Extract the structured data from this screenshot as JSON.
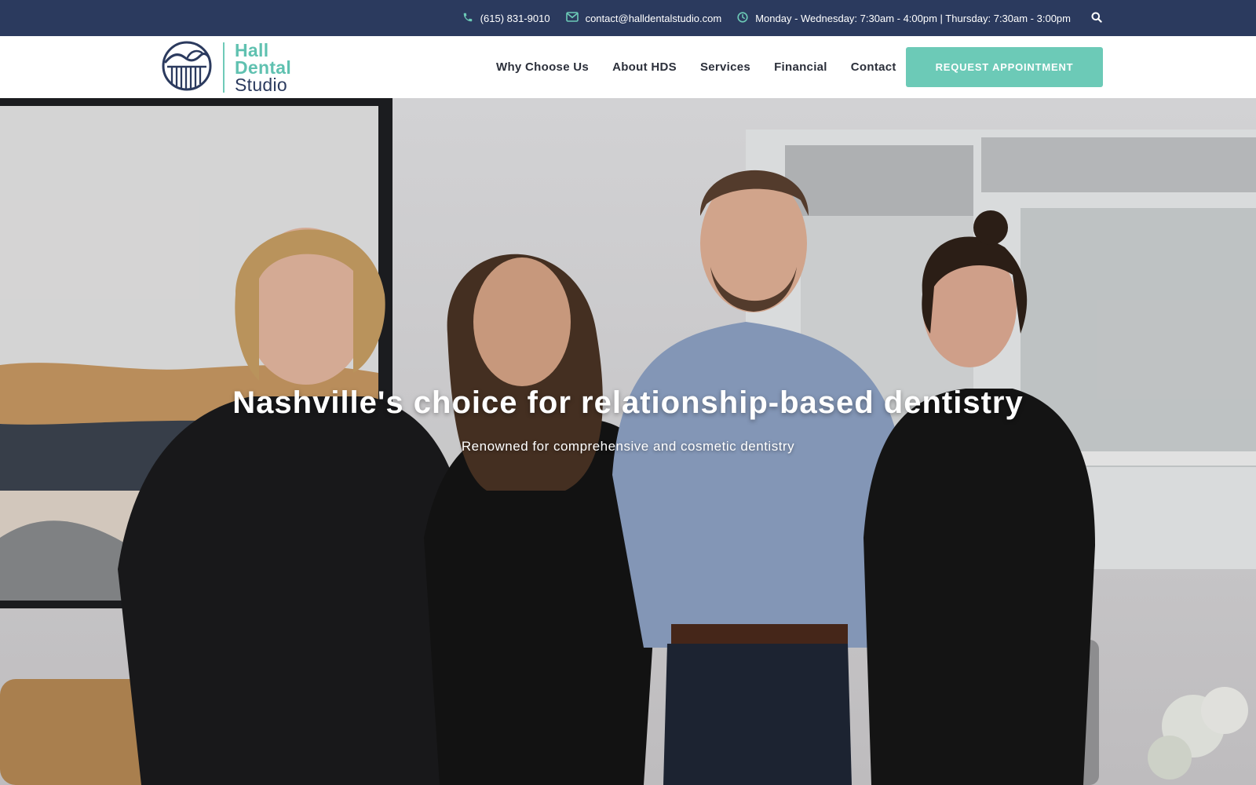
{
  "topbar": {
    "phone": "(615) 831-9010",
    "email": "contact@halldentalstudio.com",
    "hours": "Monday - Wednesday: 7:30am - 4:00pm | Thursday: 7:30am - 3:00pm",
    "icons": {
      "phone": "phone-icon",
      "email": "envelope-icon",
      "hours": "clock-icon",
      "search": "search-icon"
    }
  },
  "logo": {
    "line1": "Hall",
    "line2": "Dental",
    "line3": "Studio"
  },
  "nav": {
    "items": [
      {
        "label": "Why Choose Us"
      },
      {
        "label": "About HDS"
      },
      {
        "label": "Services"
      },
      {
        "label": "Financial"
      },
      {
        "label": "Contact"
      }
    ],
    "cta_label": "REQUEST APPOINTMENT"
  },
  "hero": {
    "title": "Nashville's choice for relationship-based dentistry",
    "subtitle": "Renowned for comprehensive and cosmetic dentistry"
  },
  "colors": {
    "topbar_bg": "#2b3a5e",
    "accent_teal": "#6ccab7",
    "nav_text": "#2b2f3a",
    "logo_navy": "#2b3a5e"
  }
}
